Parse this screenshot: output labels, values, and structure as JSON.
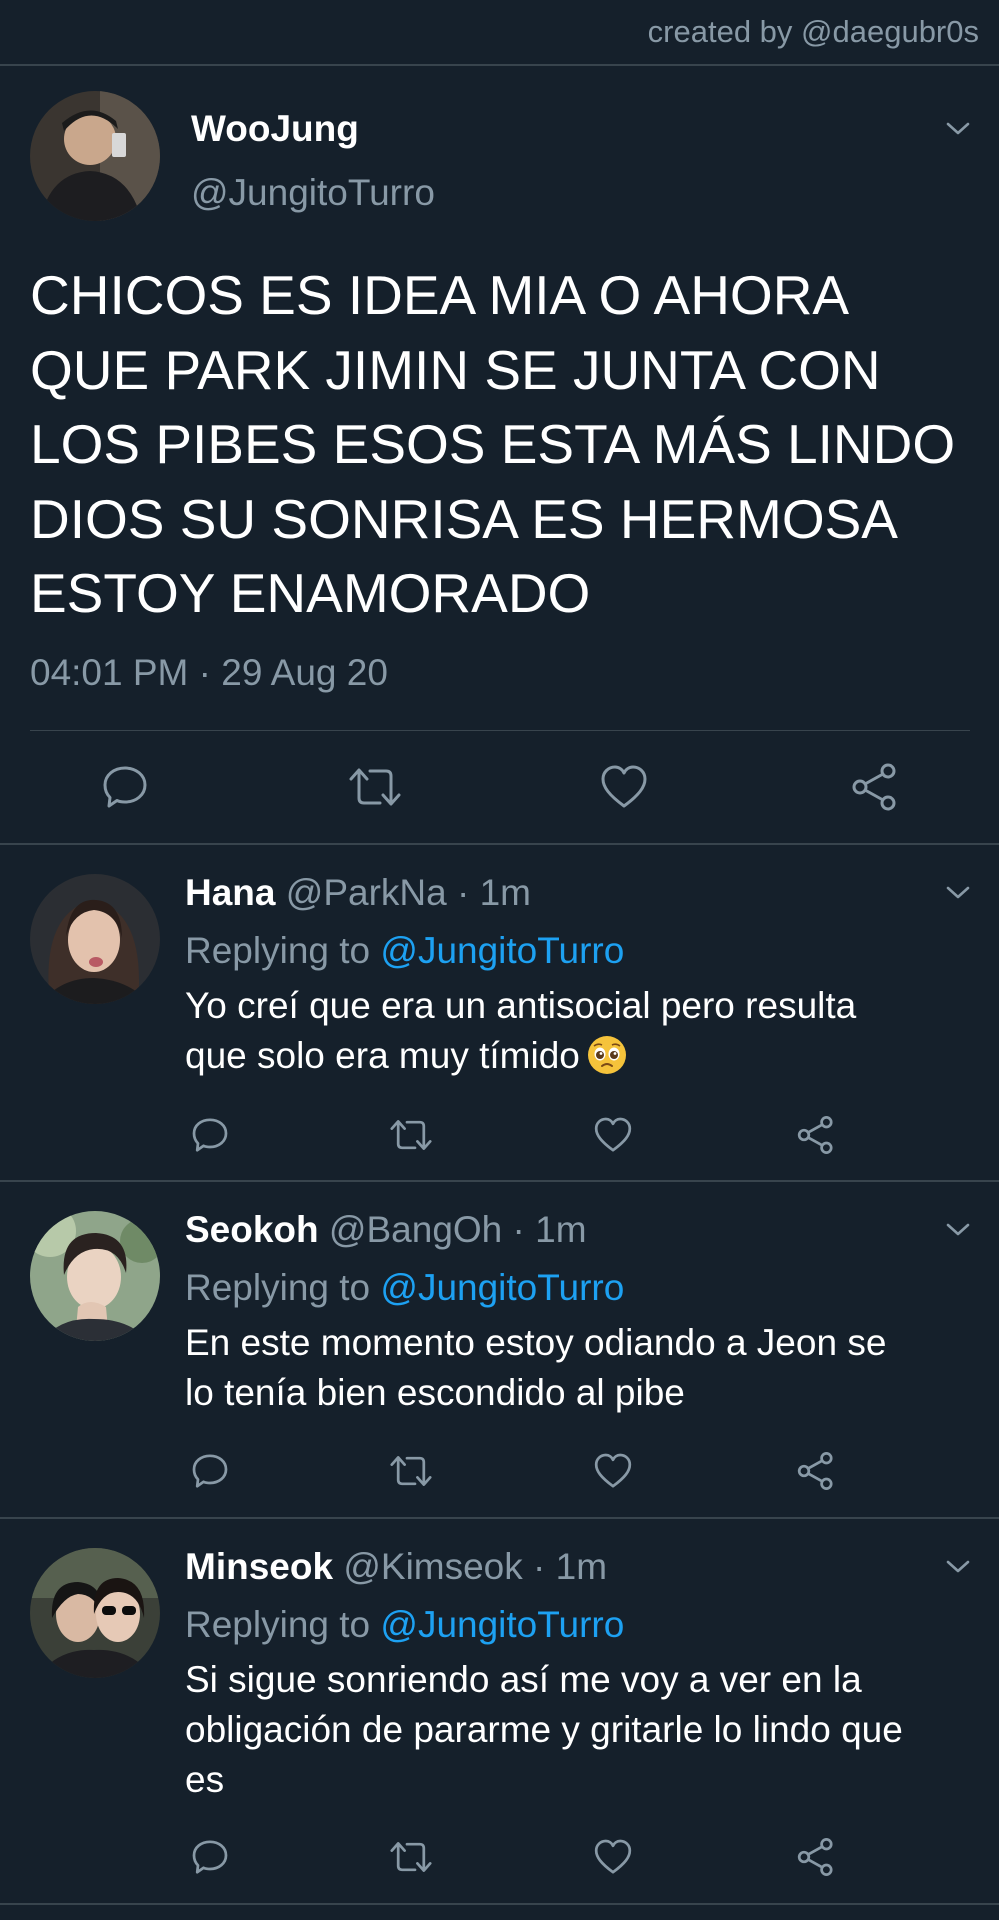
{
  "credit": "created by @daegubr0s",
  "main_tweet": {
    "name": "WooJung",
    "handle": "@JungitoTurro",
    "text": "CHICOS ES IDEA MIA O AHORA\nQUE PARK JIMIN SE JUNTA CON\nLOS PIBES ESOS ESTA MÁS LINDO\nDIOS SU SONRISA ES HERMOSA\nESTOY ENAMORADO",
    "timestamp": "04:01 PM · 29 Aug 20"
  },
  "replies": [
    {
      "name": "Hana",
      "meta": "@ParkNa · 1m",
      "replying_prefix": "Replying to ",
      "replying_to": "@JungitoTurro",
      "text": "Yo creí que era un antisocial pero resulta\nque solo era muy tímido",
      "emoji": "pleading-face-emoji"
    },
    {
      "name": "Seokoh",
      "meta": "@BangOh · 1m",
      "replying_prefix": "Replying to ",
      "replying_to": "@JungitoTurro",
      "text": "En este momento estoy odiando a Jeon se\nlo tenía bien escondido al pibe"
    },
    {
      "name": "Minseok",
      "meta": "@Kimseok · 1m",
      "replying_prefix": "Replying to ",
      "replying_to": "@JungitoTurro",
      "text": "Si sigue sonriendo así me voy a ver en la\nobligación de pararme y gritarle lo lindo que\nes"
    }
  ],
  "icons": [
    "reply-icon",
    "retweet-icon",
    "like-icon",
    "share-icon",
    "chevron-down-icon"
  ],
  "colors": {
    "background": "#15202b",
    "text": "#ffffff",
    "muted": "#8899a6",
    "accent": "#1da1f2",
    "divider": "#38444d"
  }
}
